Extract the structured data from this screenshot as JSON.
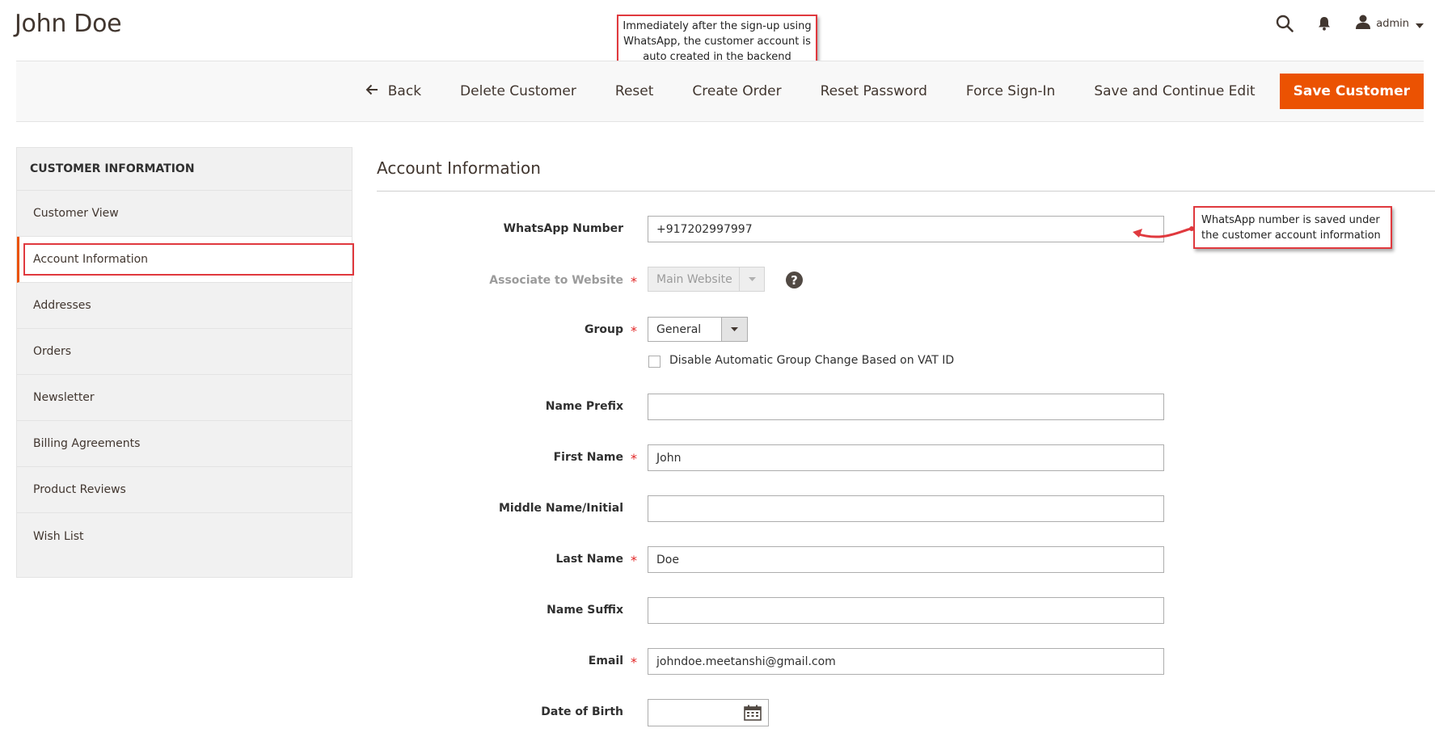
{
  "header": {
    "page_title": "John Doe",
    "user_name": "admin"
  },
  "icons": {
    "search": "search-icon",
    "notifications": "bell-icon",
    "user": "user-icon",
    "back": "arrow-left-icon"
  },
  "actions": {
    "back": "Back",
    "delete": "Delete Customer",
    "reset": "Reset",
    "create_order": "Create Order",
    "reset_password": "Reset Password",
    "force_signin": "Force Sign-In",
    "save_continue": "Save and Continue Edit",
    "save": "Save Customer"
  },
  "callouts": {
    "top": "Immediately after the sign-up using WhatsApp, the customer account is auto created in the backend",
    "right": "WhatsApp number is saved under the customer account information"
  },
  "sidebar": {
    "title": "CUSTOMER INFORMATION",
    "items": [
      {
        "label": "Customer View"
      },
      {
        "label": "Account Information",
        "active": true
      },
      {
        "label": "Addresses"
      },
      {
        "label": "Orders"
      },
      {
        "label": "Newsletter"
      },
      {
        "label": "Billing Agreements"
      },
      {
        "label": "Product Reviews"
      },
      {
        "label": "Wish List"
      }
    ]
  },
  "form": {
    "section_title": "Account Information",
    "whatsapp": {
      "label": "WhatsApp Number",
      "value": "+917202997997"
    },
    "website": {
      "label": "Associate to Website",
      "value": "Main Website",
      "required": "*"
    },
    "group": {
      "label": "Group",
      "value": "General",
      "required": "*"
    },
    "disable_vat": {
      "label": "Disable Automatic Group Change Based on VAT ID",
      "checked": false
    },
    "prefix": {
      "label": "Name Prefix",
      "value": ""
    },
    "first_name": {
      "label": "First Name",
      "value": "John",
      "required": "*"
    },
    "middle_name": {
      "label": "Middle Name/Initial",
      "value": ""
    },
    "last_name": {
      "label": "Last Name",
      "value": "Doe",
      "required": "*"
    },
    "suffix": {
      "label": "Name Suffix",
      "value": ""
    },
    "email": {
      "label": "Email",
      "value": "johndoe.meetanshi@gmail.com",
      "required": "*"
    },
    "dob": {
      "label": "Date of Birth",
      "value": ""
    }
  },
  "colors": {
    "accent": "#eb5202",
    "callout_border": "#e0393e",
    "required": "#e22626"
  }
}
